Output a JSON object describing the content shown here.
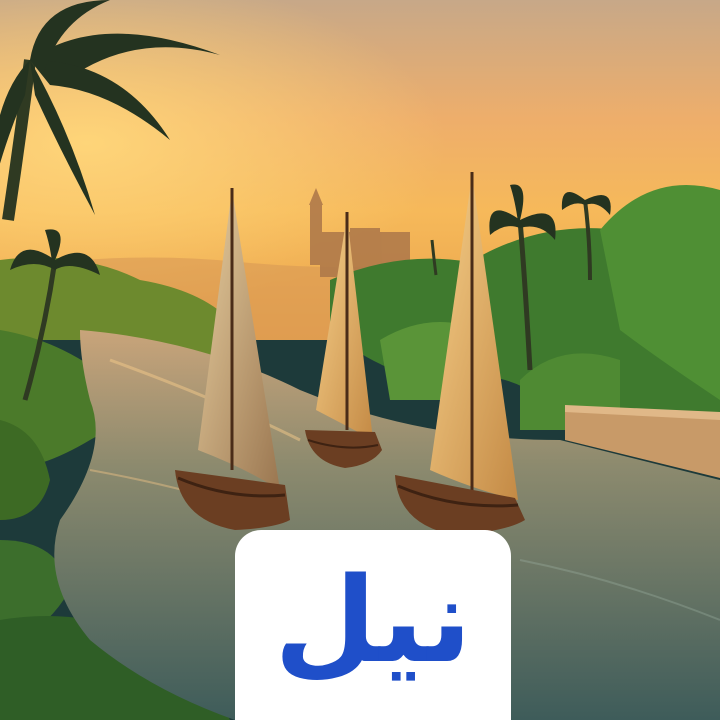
{
  "logo": {
    "text": "نيل",
    "color": "#1f4fc9",
    "background": "#ffffff"
  },
  "scene": {
    "palette": {
      "sky_top": "#c7a27e",
      "sky_mid": "#f1a75a",
      "sky_glow": "#f6c15a",
      "river": "#5b6f64",
      "sail": "#e9b86a",
      "hull": "#6b3e22",
      "foliage": "#3f7a2e"
    }
  }
}
